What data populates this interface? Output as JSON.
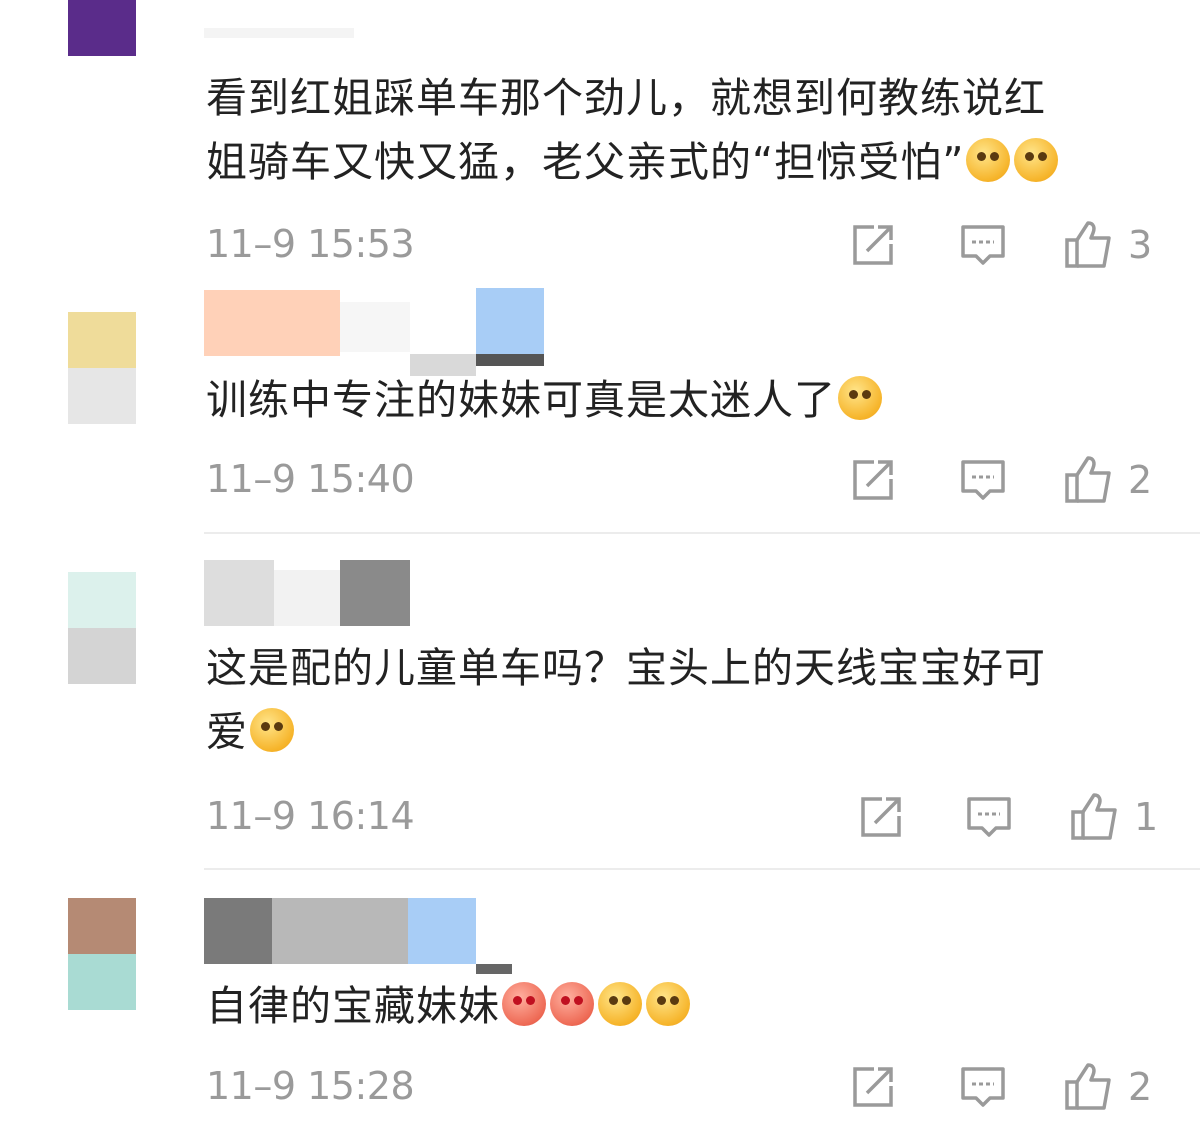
{
  "comments": [
    {
      "text": "看到红姐踩单车那个劲儿，就想到何教练说红\n姐骑车又快又猛，老父亲式的“担惊受怕”",
      "emojis": [
        "laugh-cry-emoji",
        "laugh-cry-emoji"
      ],
      "time": "11–9 15:53",
      "likes": "3",
      "avatar_colors": [
        "#5a2c8a",
        "#ffffff"
      ]
    },
    {
      "text": "训练中专注的妹妹可真是太迷人了",
      "emojis": [
        "sleepy-smile-emoji"
      ],
      "time": "11–9 15:40",
      "likes": "2",
      "avatar_colors": [
        "#efdc9a",
        "#e6e6e6"
      ]
    },
    {
      "text": "这是配的儿童单车吗？宝头上的天线宝宝好可\n爱",
      "emojis": [
        "kiss-emoji"
      ],
      "time": "11–9 16:14",
      "likes": "1",
      "avatar_colors": [
        "#dcf1ec",
        "#d4d4d4"
      ]
    },
    {
      "text": "自律的宝藏妹妹",
      "emojis": [
        "heart-eyes-emoji",
        "heart-eyes-emoji",
        "cheer-emoji",
        "cheer-emoji"
      ],
      "time": "11–9 15:28",
      "likes": "2",
      "avatar_colors": [
        "#b58a74",
        "#a9dbd3"
      ]
    }
  ],
  "colors": {
    "text": "#222222",
    "meta": "#9a9a9a",
    "divider": "#ececec"
  },
  "icons": [
    "share-icon",
    "reply-comment-icon",
    "like-thumb-icon"
  ]
}
